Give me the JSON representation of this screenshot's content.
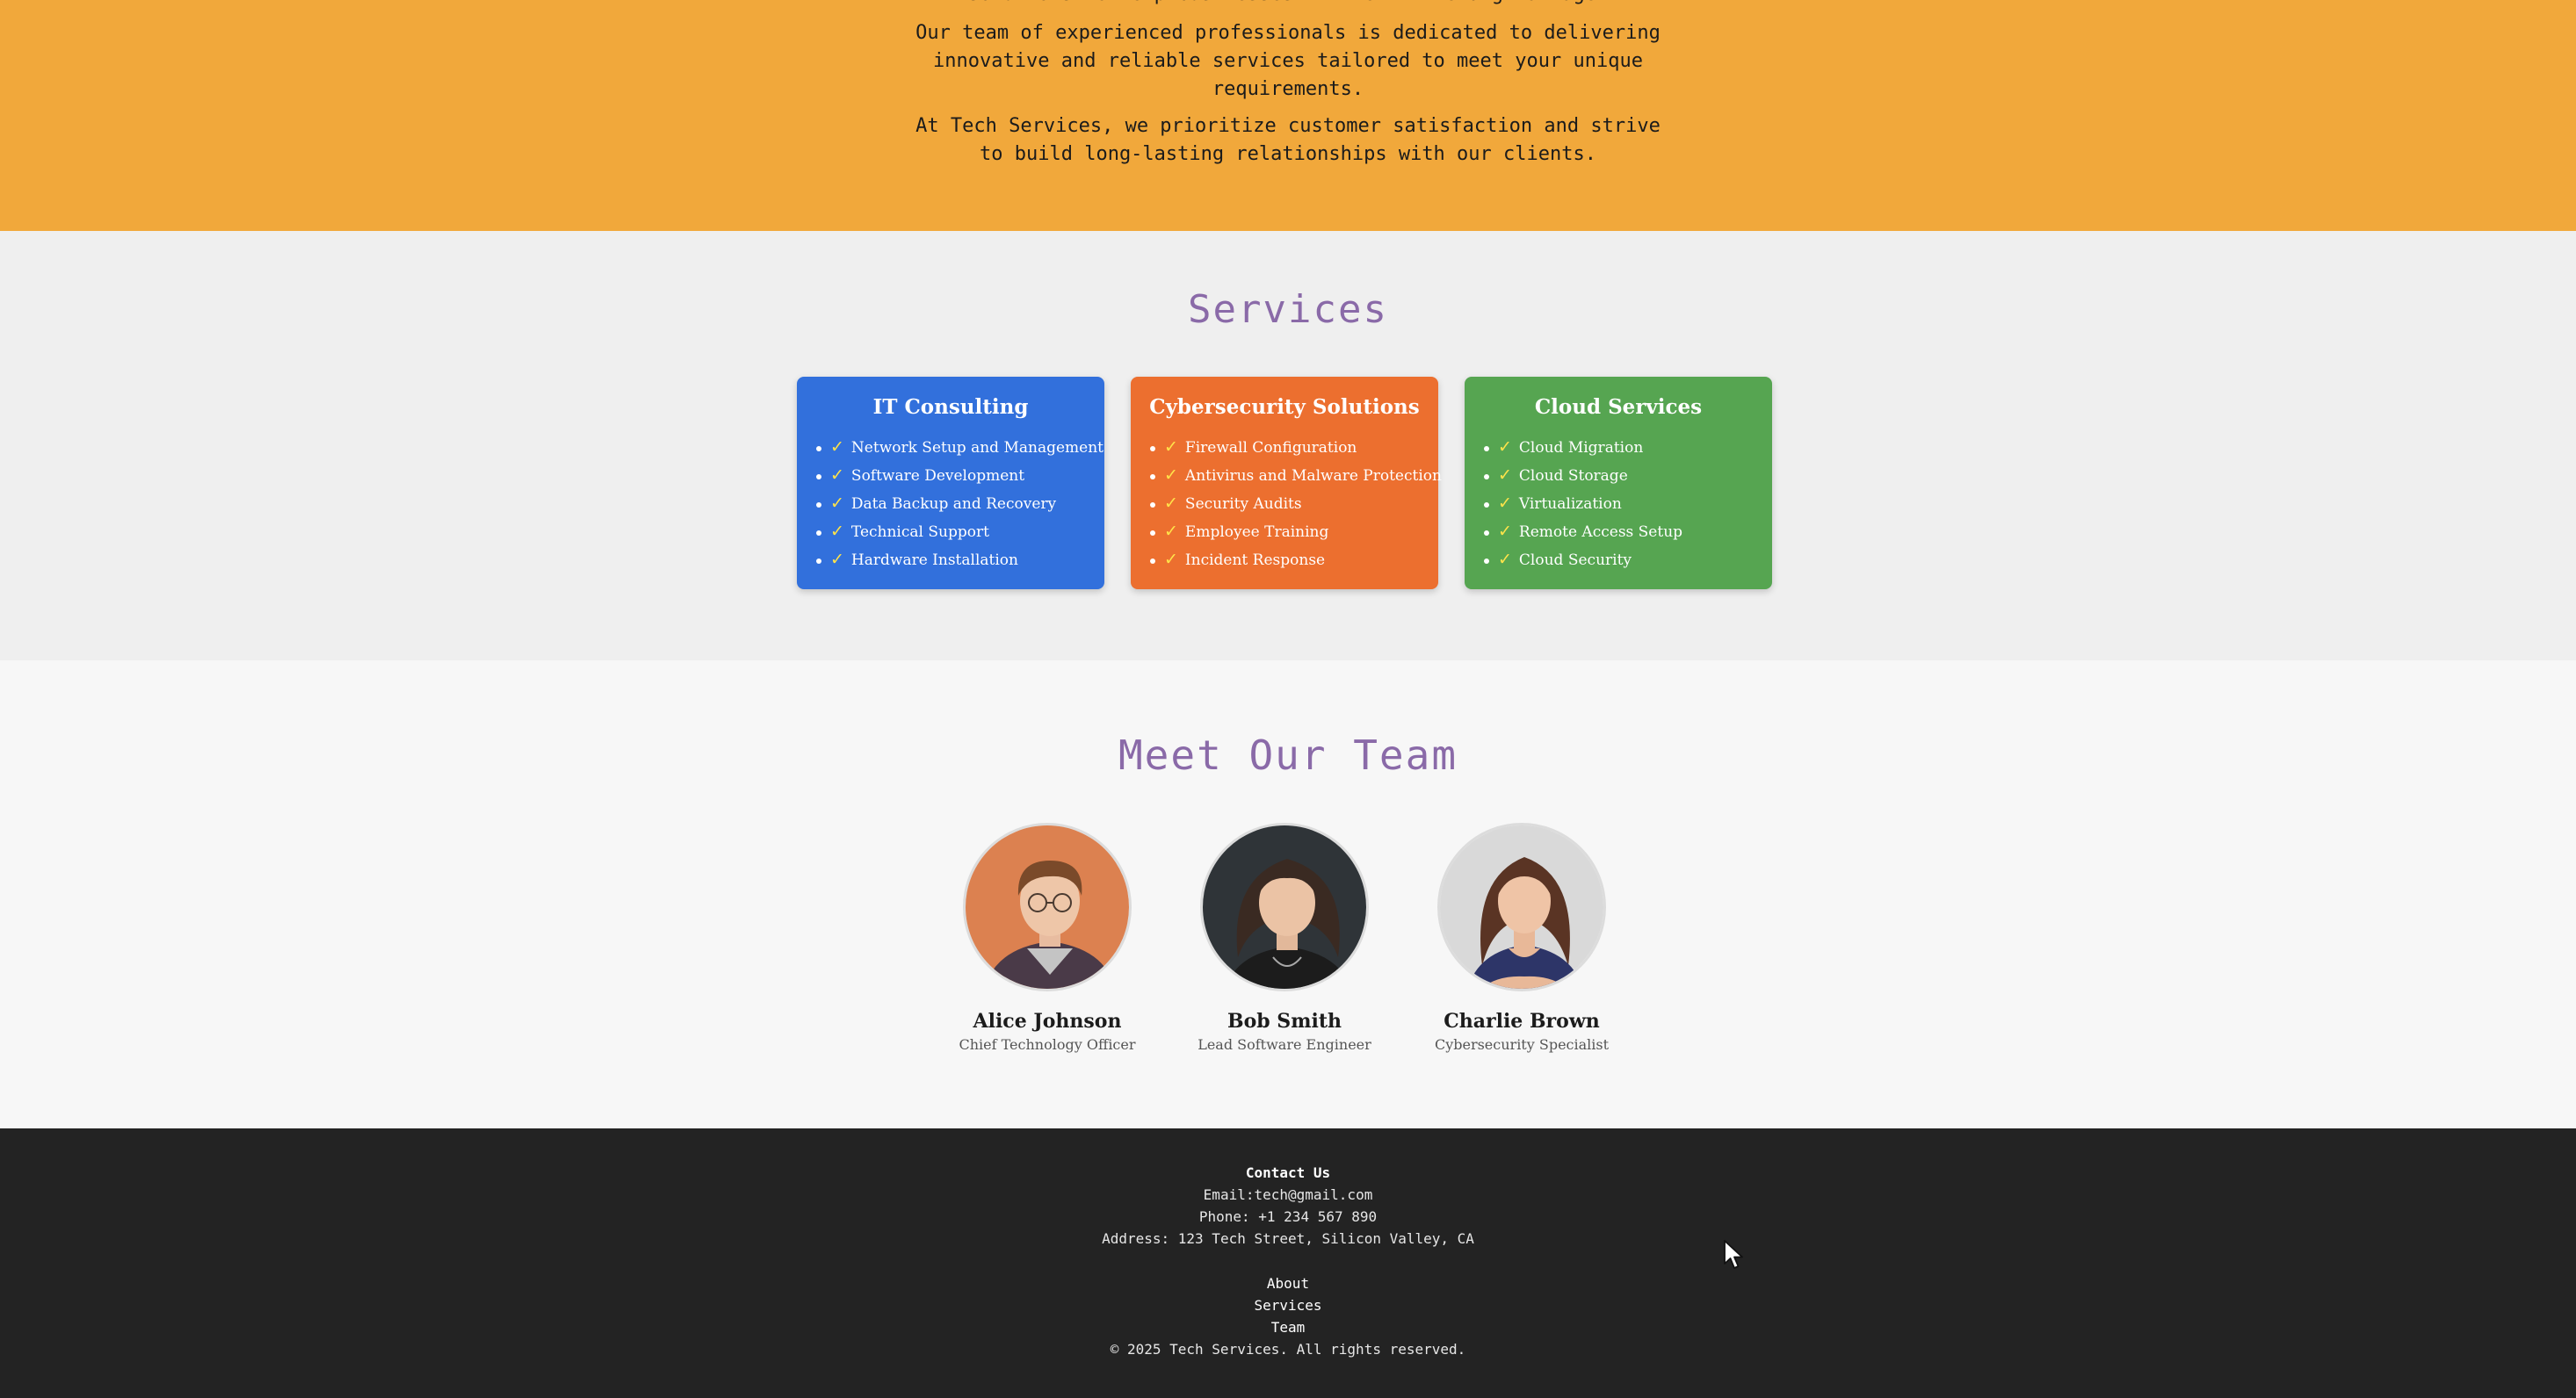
{
  "about": {
    "partial_line": "solutions to help businesses thrive in the digital age.",
    "paragraph1": [
      "Our team of experienced professionals is dedicated to delivering",
      "innovative and reliable services tailored to meet your unique",
      "requirements."
    ],
    "paragraph2": [
      "At Tech Services, we prioritize customer satisfaction and strive",
      "to build long-lasting relationships with our clients."
    ],
    "background_color": "#f1a83b"
  },
  "services": {
    "title": "Services",
    "cards": [
      {
        "title": "IT Consulting",
        "color": "#3270dc",
        "items": [
          "Network Setup and Management",
          "Software Development",
          "Data Backup and Recovery",
          "Technical Support",
          "Hardware Installation"
        ]
      },
      {
        "title": "Cybersecurity Solutions",
        "color": "#ec6f2f",
        "items": [
          "Firewall Configuration",
          "Antivirus and Malware Protection",
          "Security Audits",
          "Employee Training",
          "Incident Response"
        ]
      },
      {
        "title": "Cloud Services",
        "color": "#56a551",
        "items": [
          "Cloud Migration",
          "Cloud Storage",
          "Virtualization",
          "Remote Access Setup",
          "Cloud Security"
        ]
      }
    ],
    "check_glyph": "✓"
  },
  "team": {
    "title": "Meet Our Team",
    "members": [
      {
        "name": "Alice Johnson",
        "role": "Chief Technology Officer"
      },
      {
        "name": "Bob Smith",
        "role": "Lead Software Engineer"
      },
      {
        "name": "Charlie Brown",
        "role": "Cybersecurity Specialist"
      }
    ]
  },
  "footer": {
    "contact_heading": "Contact Us",
    "email": "Email:tech@gmail.com",
    "phone": "Phone: +1 234 567 890",
    "address": "Address: 123 Tech Street, Silicon Valley, CA",
    "links": [
      "About",
      "Services",
      "Team"
    ],
    "copyright": "© 2025 Tech Services. All rights reserved."
  },
  "icons": {
    "cursor": "mouse-pointer-icon"
  }
}
